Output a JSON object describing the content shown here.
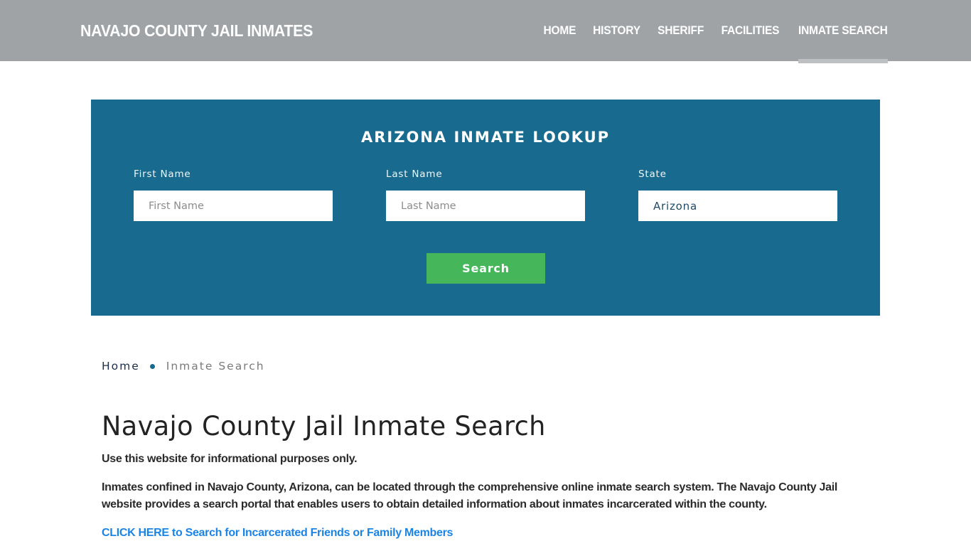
{
  "header": {
    "brand": "NAVAJO COUNTY JAIL INMATES",
    "nav": [
      {
        "label": "HOME",
        "active": false
      },
      {
        "label": "HISTORY",
        "active": false
      },
      {
        "label": "SHERIFF",
        "active": false
      },
      {
        "label": "FACILITIES",
        "active": false
      },
      {
        "label": "INMATE SEARCH",
        "active": true
      }
    ]
  },
  "lookup": {
    "title": "ARIZONA INMATE LOOKUP",
    "first_name": {
      "label": "First Name",
      "placeholder": "First Name",
      "value": ""
    },
    "last_name": {
      "label": "Last Name",
      "placeholder": "Last Name",
      "value": ""
    },
    "state": {
      "label": "State",
      "value": "Arizona"
    },
    "search_button": "Search"
  },
  "breadcrumb": {
    "home": "Home",
    "current": "Inmate Search"
  },
  "content": {
    "title": "Navajo County Jail Inmate Search",
    "paragraphs": [
      "Use this website for informational purposes only.",
      "Inmates confined in Navajo County, Arizona, can be located through the comprehensive online inmate search system. The Navajo County Jail website provides a search portal that enables users to obtain detailed information about inmates incarcerated within the county."
    ],
    "cta_link": "CLICK HERE to Search for Incarcerated Friends or Family Members"
  },
  "colors": {
    "header_bg": "#9fa3a6",
    "lookup_bg": "#186b8e",
    "button_green": "#45b75a",
    "link_blue": "#1a84e6"
  }
}
